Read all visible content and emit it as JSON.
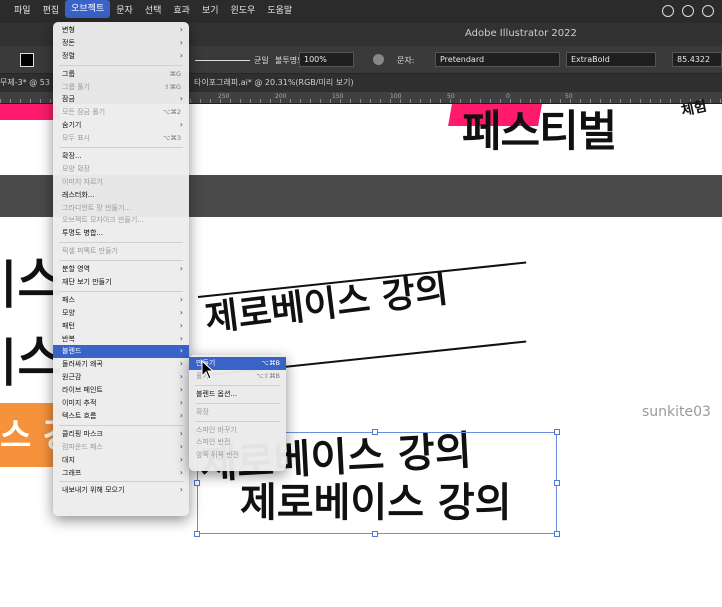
{
  "menubar": {
    "items": [
      "파일",
      "편집",
      "오브젝트",
      "문자",
      "선택",
      "효과",
      "보기",
      "윈도우",
      "도움말"
    ],
    "active_index": 2
  },
  "titlebar": {
    "title": "Adobe Illustrator 2022"
  },
  "controlbar": {
    "stroke_style": "균일",
    "opacity_label": "불투명도:",
    "opacity_value": "100%",
    "char_label": "문자:",
    "font_name": "Pretendard",
    "font_weight": "ExtraBold",
    "font_size": "85.4322"
  },
  "tabs": {
    "left": "무제-3* @ 53",
    "right": "타이포그래피.ai* @ 20.31%(RGB/미리 보기)"
  },
  "ruler": {
    "labels": [
      "250",
      "200",
      "150",
      "100",
      "50",
      "0",
      "50"
    ]
  },
  "canvas": {
    "festival_text": "페스티벌",
    "small_text": "체험",
    "side_text_1": "|스",
    "side_text_2": "|스",
    "orange_text": "스 강",
    "heading_text": "제로베이스 강의",
    "blend_text_1": "제로베이스 강의",
    "blend_text_2": "제로베이스 강의",
    "watermark": "sunkite03"
  },
  "object_menu": {
    "items": [
      {
        "label": "변형",
        "submenu": true
      },
      {
        "label": "정돈",
        "submenu": true
      },
      {
        "label": "정렬",
        "submenu": true
      },
      {
        "sep": true
      },
      {
        "label": "그룹",
        "shortcut": "⌘G",
        "disabled": false
      },
      {
        "label": "그룹 풀기",
        "shortcut": "⇧⌘G",
        "disabled": true
      },
      {
        "label": "잠금",
        "submenu": true
      },
      {
        "label": "모든 잠금 풀기",
        "shortcut": "⌥⌘2",
        "disabled": true
      },
      {
        "label": "숨기기",
        "submenu": true
      },
      {
        "label": "모두 표시",
        "shortcut": "⌥⌘3",
        "disabled": true
      },
      {
        "sep": true
      },
      {
        "label": "확장..."
      },
      {
        "label": "모양 확장",
        "disabled": true
      },
      {
        "label": "이미지 자르기",
        "disabled": true
      },
      {
        "label": "래스터화..."
      },
      {
        "label": "그라디언트 망 만들기...",
        "disabled": true
      },
      {
        "label": "오브젝트 모자이크 만들기...",
        "disabled": true
      },
      {
        "label": "투명도 병합..."
      },
      {
        "sep": true
      },
      {
        "label": "픽셀 퍼펙트 만들기",
        "disabled": true
      },
      {
        "sep": true
      },
      {
        "label": "분할 영역",
        "submenu": true
      },
      {
        "label": "재단 보기 만들기"
      },
      {
        "sep": true
      },
      {
        "label": "패스",
        "submenu": true
      },
      {
        "label": "모양",
        "submenu": true
      },
      {
        "label": "패턴",
        "submenu": true
      },
      {
        "label": "반복",
        "submenu": true
      },
      {
        "label": "블렌드",
        "submenu": true,
        "active": true
      },
      {
        "label": "둘러싸기 왜곡",
        "submenu": true
      },
      {
        "label": "원근감",
        "submenu": true
      },
      {
        "label": "라이브 페인트",
        "submenu": true
      },
      {
        "label": "이미지 추적",
        "submenu": true
      },
      {
        "label": "텍스트 흐름",
        "submenu": true
      },
      {
        "sep": true
      },
      {
        "label": "클리핑 마스크",
        "submenu": true
      },
      {
        "label": "컴파운드 패스",
        "submenu": true,
        "disabled": true
      },
      {
        "label": "대지",
        "submenu": true
      },
      {
        "label": "그래프",
        "submenu": true
      },
      {
        "sep": true
      },
      {
        "label": "내보내기 위해 모으기",
        "submenu": true
      }
    ]
  },
  "blend_submenu": {
    "items": [
      {
        "label": "만들기",
        "shortcut": "⌥⌘B",
        "active": true
      },
      {
        "label": "풀기",
        "shortcut": "⌥⇧⌘B",
        "disabled": true
      },
      {
        "sep": true
      },
      {
        "label": "블렌드 옵션..."
      },
      {
        "sep": true
      },
      {
        "label": "확장",
        "disabled": true
      },
      {
        "sep": true
      },
      {
        "label": "스파인 바꾸기",
        "disabled": true
      },
      {
        "label": "스파인 반전",
        "disabled": true
      },
      {
        "label": "앞쪽 뒤쪽 반전",
        "disabled": true
      }
    ]
  },
  "colors": {
    "accent_pink": "#ff1a6b",
    "accent_orange": "#f6923c",
    "menu_highlight": "#3a63c8",
    "selection": "#6b8fe0"
  }
}
